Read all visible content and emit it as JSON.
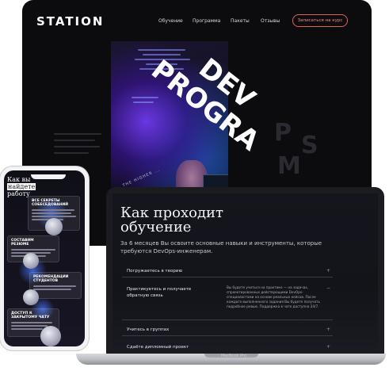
{
  "desktop": {
    "logo": "STATION",
    "nav": [
      "Обучение",
      "Программа",
      "Пакеты",
      "Отзывы"
    ],
    "cta": "Записаться на курс",
    "hero_word_1": "DEV",
    "hero_word_2": "PROGRA",
    "ghost_letters": [
      "P",
      "S",
      "M"
    ],
    "curved_caption": "THE HIGHER ..."
  },
  "laptop": {
    "title_line_1": "Как проходит",
    "title_line_2": "обучение",
    "subtitle": "За 6 месяцев Вы освоите основные навыки и инструменты, которые требуются DevOps-инженерам.",
    "accordion": [
      {
        "label": "Погружаетесь в теорию",
        "icon": "+"
      },
      {
        "label": "Практикуетесь и получаете обратную связь",
        "icon": "−",
        "body": "Вы будете учиться на практике — на задачах, спроектированных действующими DevOps-специалистами на основе реальных кейсов. После каждого выполненного задания Вы будете получать подробное ревью. Поддержка в чате доступна 24/7."
      },
      {
        "label": "Учитесь в группах",
        "icon": "+"
      },
      {
        "label": "Сдаёте дипломный проект",
        "icon": "+"
      }
    ],
    "brand": "MacBook Pro"
  },
  "phone": {
    "title_1": "Как вы",
    "title_highlight": "найдете",
    "title_2": "работу",
    "cards": [
      {
        "title_1": "ВСЕ СЕКРЕТЫ",
        "title_2": "СОБЕСЕДОВАНИЙ"
      },
      {
        "title_1": "СОСТАВИМ",
        "title_2": "РЕЗЮМЕ"
      },
      {
        "title_1": "РЕКОМЕНДАЦИИ",
        "title_2": "СТУДЕНТОВ"
      },
      {
        "title_1": "ДОСТУП К",
        "title_2": "ЗАКРЫТОМУ ЧАТУ"
      }
    ]
  }
}
